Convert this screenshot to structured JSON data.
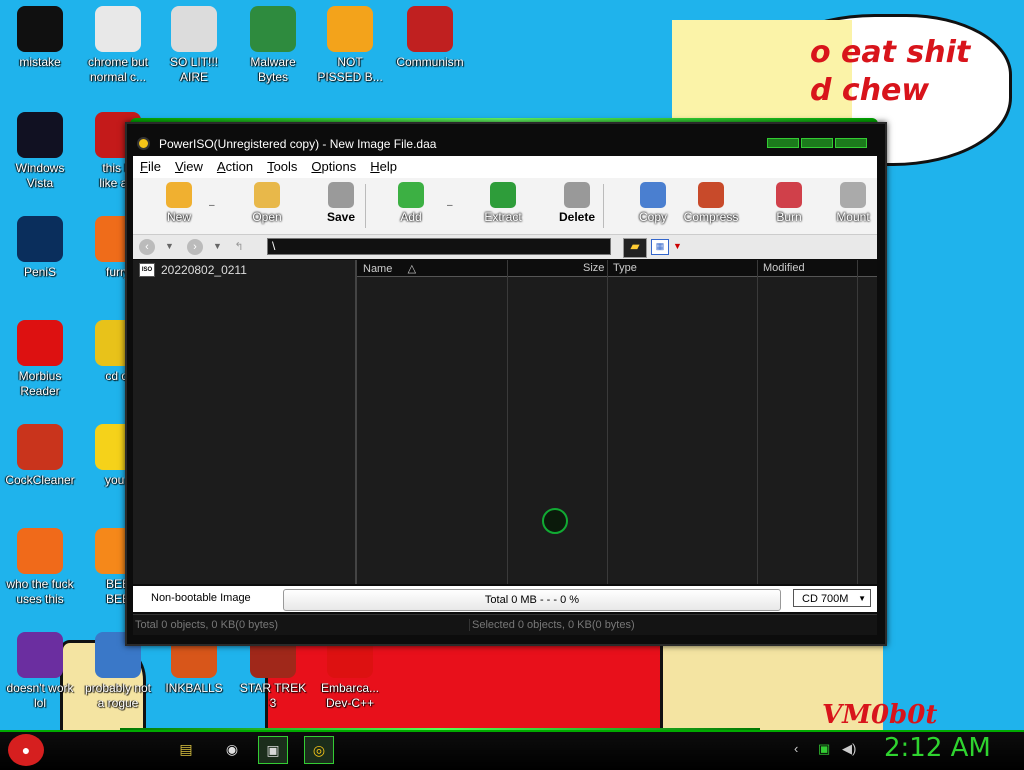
{
  "wallpaper": {
    "speech_text": "o eat shit\nd chew",
    "signature": "VM0b0t"
  },
  "desktop_icons": [
    {
      "label": "mistake",
      "icon": "razer-icon",
      "color": "#101010"
    },
    {
      "label": "chrome but\nnormal c...",
      "icon": "chrome-icon",
      "color": "#e8e8e8"
    },
    {
      "label": "SO LIT!!!\nAIRE",
      "icon": "solitaire-icon",
      "color": "#dcdcdc"
    },
    {
      "label": "Malware\nBytes",
      "icon": "shield-icon",
      "color": "#2e8b3e"
    },
    {
      "label": "NOT\nPISSED B...",
      "icon": "angry-pig-icon",
      "color": "#f3a31b"
    },
    {
      "label": "Communism",
      "icon": "communism-icon",
      "color": "#c02020"
    },
    {
      "label": "Windows\nVista",
      "icon": "recycle-icon",
      "color": "#112"
    },
    {
      "label": "this lo\nlike a v",
      "icon": "opera-icon",
      "color": "#c41a1a"
    },
    {
      "label": "PeniS",
      "icon": "photoshop-icon",
      "color": "#0a2e5c"
    },
    {
      "label": "furry",
      "icon": "firefox-icon",
      "color": "#ef6c1a"
    },
    {
      "label": "Morbius\nReader",
      "icon": "pdf-icon",
      "color": "#d11"
    },
    {
      "label": "cd di",
      "icon": "cd-icon",
      "color": "#e8c21a"
    },
    {
      "label": "CockCleaner",
      "icon": "ccleaner-icon",
      "color": "#c9341c"
    },
    {
      "label": "you t",
      "icon": "star-icon",
      "color": "#f5d21a"
    },
    {
      "label": "who the fuck\nuses this",
      "icon": "thunder-icon",
      "color": "#f06a1a"
    },
    {
      "label": "BEE\nBEE",
      "icon": "vlc-icon",
      "color": "#f5881a"
    },
    {
      "label": "doesn't work\nlol",
      "icon": "yahoo-messenger-icon",
      "color": "#6b2ea0"
    },
    {
      "label": "probably not\na rogue",
      "icon": "gear-icon",
      "color": "#3a78c8"
    },
    {
      "label": "INKBALLS",
      "icon": "inkball-icon",
      "color": "#d8561a"
    },
    {
      "label": "STAR TREK\n3",
      "icon": "star-wars-icon",
      "color": "#a0281a"
    },
    {
      "label": "Embarca...\nDev-C++",
      "icon": "devcpp-icon",
      "color": "#d11"
    }
  ],
  "window": {
    "title": "PowerISO(Unregistered copy) - New Image File.daa",
    "menu": [
      "File",
      "View",
      "Action",
      "Tools",
      "Options",
      "Help"
    ],
    "toolbar": [
      {
        "label": "New",
        "icon": "new-file-icon",
        "color": "#f0b030"
      },
      {
        "label": "Open",
        "icon": "open-folder-icon",
        "color": "#e8b84a"
      },
      {
        "label": "Save",
        "icon": "save-icon",
        "color": "#9a9a9a",
        "bold": true
      },
      {
        "label": "Add",
        "icon": "add-icon",
        "color": "#3cb043"
      },
      {
        "label": "Extract",
        "icon": "extract-icon",
        "color": "#2e9d3a"
      },
      {
        "label": "Delete",
        "icon": "delete-icon",
        "color": "#999",
        "bold": true
      },
      {
        "label": "Copy",
        "icon": "copy-disc-icon",
        "color": "#4a7fd0"
      },
      {
        "label": "Compress",
        "icon": "compress-icon",
        "color": "#c84a2a"
      },
      {
        "label": "Burn",
        "icon": "burn-icon",
        "color": "#d0404a"
      },
      {
        "label": "Mount",
        "icon": "mount-icon",
        "color": "#aaa"
      }
    ],
    "path": "\\",
    "tree_item": "20220802_0211",
    "columns": [
      "Name",
      "Size",
      "Type",
      "Modified"
    ],
    "boot_status": "Non-bootable Image",
    "progress_text": "Total  0 MB   - - -  0 %",
    "media": "CD 700M",
    "status_left": "Total 0 objects, 0 KB(0 bytes)",
    "status_right": "Selected 0 objects, 0 KB(0 bytes)"
  },
  "taskbar": {
    "start_icon": "angry-bird-icon",
    "items": [
      {
        "icon": "explorer-icon",
        "glyph": "▤",
        "color": "#d8c040"
      },
      {
        "icon": "chrome-icon",
        "glyph": "◉",
        "color": "#e0e0e0"
      },
      {
        "icon": "solitaire-icon",
        "glyph": "▣",
        "color": "#d8d8d8"
      },
      {
        "icon": "poweriso-icon",
        "glyph": "◎",
        "color": "#f5c518"
      }
    ],
    "tray": [
      "back-icon",
      "network-icon",
      "volume-icon"
    ],
    "clock": "2:12 AM"
  }
}
